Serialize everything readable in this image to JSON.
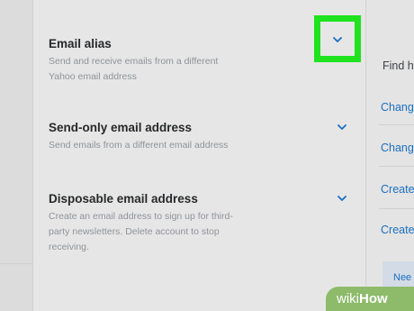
{
  "sections": [
    {
      "title": "Email alias",
      "desc_lines": [
        "Send and receive emails from a different",
        "Yahoo email address"
      ]
    },
    {
      "title": "Send-only email address",
      "desc_lines": [
        "Send emails from a different email address"
      ]
    },
    {
      "title": "Disposable email address",
      "desc_lines": [
        "Create an email address to sign up for third-",
        "party newsletters. Delete account to stop",
        "receiving."
      ]
    }
  ],
  "sidebar_right": {
    "heading": "Find h",
    "links": [
      "Chang",
      "Chang",
      "Create",
      "Create"
    ],
    "help_button": "Nee"
  },
  "watermark": {
    "wiki": "wiki",
    "how": "How"
  },
  "colors": {
    "accent_blue": "#1b6fc2",
    "highlight_green": "#1ee31e"
  },
  "icons": {
    "expand": "chevron-down-icon"
  }
}
